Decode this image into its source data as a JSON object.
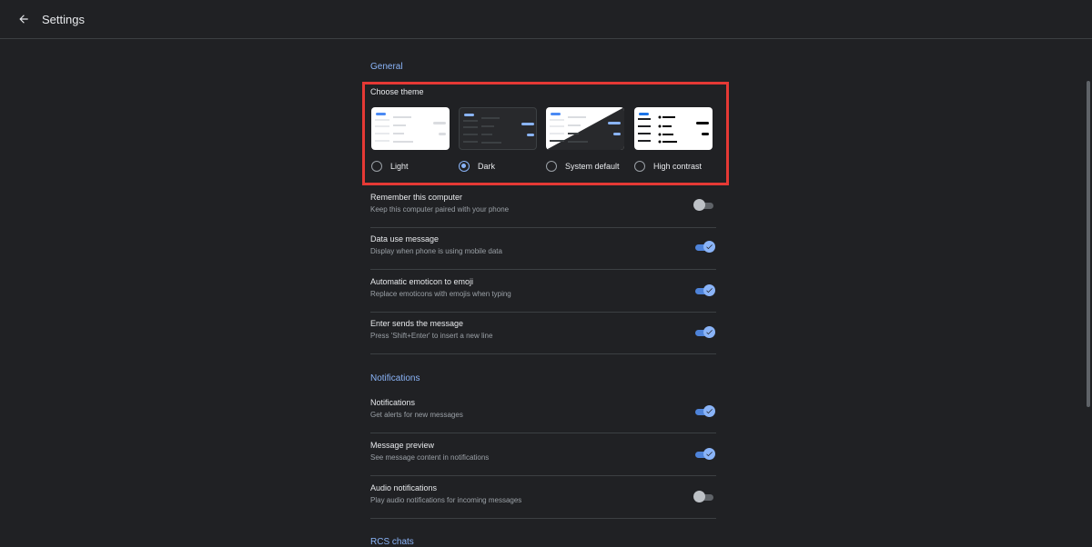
{
  "header": {
    "title": "Settings"
  },
  "sections": {
    "general": "General",
    "notifications": "Notifications",
    "rcs": "RCS chats"
  },
  "theme": {
    "label": "Choose theme",
    "options": [
      {
        "label": "Light",
        "selected": false
      },
      {
        "label": "Dark",
        "selected": true
      },
      {
        "label": "System default",
        "selected": false
      },
      {
        "label": "High contrast",
        "selected": false
      }
    ]
  },
  "settings": [
    {
      "title": "Remember this computer",
      "desc": "Keep this computer paired with your phone",
      "on": false
    },
    {
      "title": "Data use message",
      "desc": "Display when phone is using mobile data",
      "on": true
    },
    {
      "title": "Automatic emoticon to emoji",
      "desc": "Replace emoticons with emojis when typing",
      "on": true
    },
    {
      "title": "Enter sends the message",
      "desc": "Press 'Shift+Enter' to insert a new line",
      "on": true
    },
    {
      "title": "Notifications",
      "desc": "Get alerts for new messages",
      "on": true
    },
    {
      "title": "Message preview",
      "desc": "See message content in notifications",
      "on": true
    },
    {
      "title": "Audio notifications",
      "desc": "Play audio notifications for incoming messages",
      "on": false
    }
  ],
  "colors": {
    "background": "#202124",
    "accent": "#8ab4f8",
    "highlight": "#e53935"
  },
  "icons": {
    "back": "arrow-back-icon",
    "toggle_check": "check-icon"
  }
}
